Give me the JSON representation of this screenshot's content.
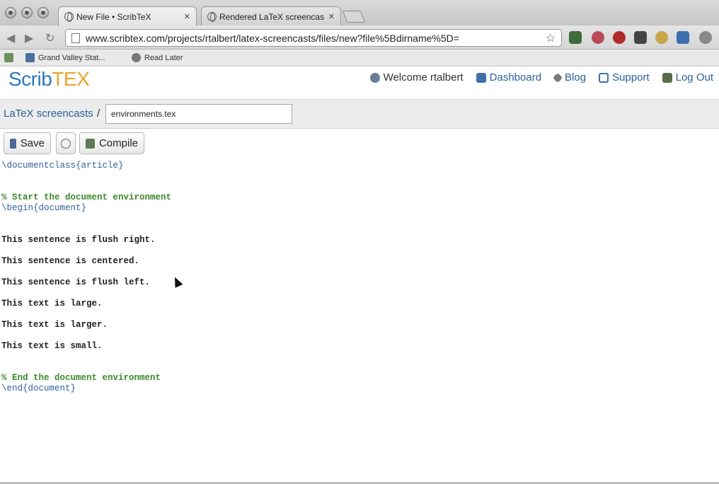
{
  "browser": {
    "tabs": [
      {
        "label": "New File • ScribTeX"
      },
      {
        "label": "Rendered LaTeX screencasts"
      }
    ],
    "url": "www.scribtex.com/projects/rtalbert/latex-screencasts/files/new?file%5Bdirname%5D=",
    "bookmarks": [
      {
        "label": "Grand Valley Stat..."
      },
      {
        "label": "Read Later"
      }
    ]
  },
  "site": {
    "logo_main": "Scrib",
    "logo_tex": "TEX",
    "nav": {
      "welcome": "Welcome rtalbert",
      "dashboard": "Dashboard",
      "blog": "Blog",
      "support": "Support",
      "logout": "Log Out"
    }
  },
  "breadcrumb": {
    "project": "LaTeX screencasts",
    "separator": "/",
    "filename": "environments.tex"
  },
  "actions": {
    "save": "Save",
    "compile": "Compile"
  },
  "editor": {
    "lines": {
      "l1_cmd": "\\documentclass",
      "l1_arg": "{article}",
      "l2_comment": "% Start the document environment",
      "l3_cmd": "\\begin",
      "l3_arg": "{document}",
      "l4": "This sentence is flush right.",
      "l5": "This sentence is centered.",
      "l6": "This sentence is flush left.",
      "l7": "This text is large.",
      "l8": "This text is larger.",
      "l9": "This text is small.",
      "l10_comment": "% End the document environment",
      "l11_cmd": "\\end",
      "l11_arg": "{document}"
    }
  },
  "colors": {
    "link": "#2c5f9c",
    "logo_blue": "#2c78c4",
    "logo_orange": "#e6a62b",
    "latex_command": "#2f5fa0",
    "latex_comment": "#3a8a2a"
  }
}
